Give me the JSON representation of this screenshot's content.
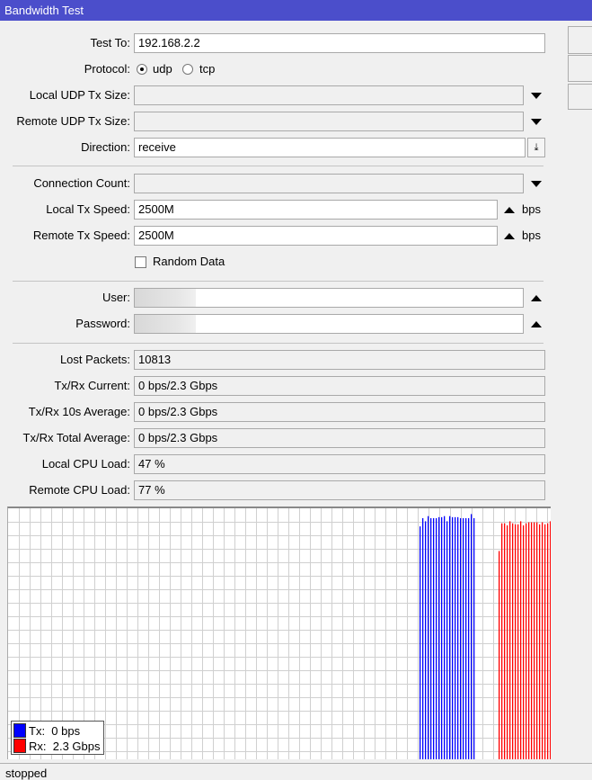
{
  "window": {
    "title": "Bandwidth Test"
  },
  "form": {
    "test_to": {
      "label": "Test To:",
      "value": "192.168.2.2"
    },
    "protocol": {
      "label": "Protocol:",
      "options": [
        "udp",
        "tcp"
      ],
      "selected": "udp"
    },
    "local_udp_tx_size": {
      "label": "Local UDP Tx Size:",
      "value": ""
    },
    "remote_udp_tx_size": {
      "label": "Remote UDP Tx Size:",
      "value": ""
    },
    "direction": {
      "label": "Direction:",
      "value": "receive"
    },
    "connection_count": {
      "label": "Connection Count:",
      "value": ""
    },
    "local_tx_speed": {
      "label": "Local Tx Speed:",
      "value": "2500M",
      "unit": "bps"
    },
    "remote_tx_speed": {
      "label": "Remote Tx Speed:",
      "value": "2500M",
      "unit": "bps"
    },
    "random_data": {
      "label": "Random Data",
      "checked": false
    },
    "user": {
      "label": "User:",
      "value": ""
    },
    "password": {
      "label": "Password:",
      "value": ""
    }
  },
  "stats": [
    {
      "label": "Lost Packets:",
      "value": "10813"
    },
    {
      "label": "Tx/Rx Current:",
      "value": "0 bps/2.3 Gbps"
    },
    {
      "label": "Tx/Rx 10s Average:",
      "value": "0 bps/2.3 Gbps"
    },
    {
      "label": "Tx/Rx Total Average:",
      "value": "0 bps/2.3 Gbps"
    },
    {
      "label": "Local CPU Load:",
      "value": "47 %"
    },
    {
      "label": "Remote CPU Load:",
      "value": "77 %"
    }
  ],
  "chart_data": {
    "type": "bar",
    "grid": true,
    "legend_placement": "bottom-left",
    "series": [
      {
        "name": "Tx",
        "color": "#0000ff",
        "legend": "Tx:  0 bps",
        "values_gbps": [
          2.27,
          2.35,
          2.32,
          2.37,
          2.35,
          2.35,
          2.35,
          2.36,
          2.36,
          2.37,
          2.32,
          2.37,
          2.36,
          2.36,
          2.36,
          2.35,
          2.35,
          2.35,
          2.35,
          2.39,
          2.35
        ]
      },
      {
        "name": "Rx",
        "color": "#ff0000",
        "legend": "Rx:  2.3 Gbps",
        "values_gbps": [
          2.03,
          2.3,
          2.3,
          2.28,
          2.32,
          2.3,
          2.29,
          2.29,
          2.32,
          2.28,
          2.3,
          2.31,
          2.31,
          2.31,
          2.31,
          2.29,
          2.31,
          2.29,
          2.3,
          2.32
        ]
      }
    ]
  },
  "status": {
    "text": "stopped"
  }
}
